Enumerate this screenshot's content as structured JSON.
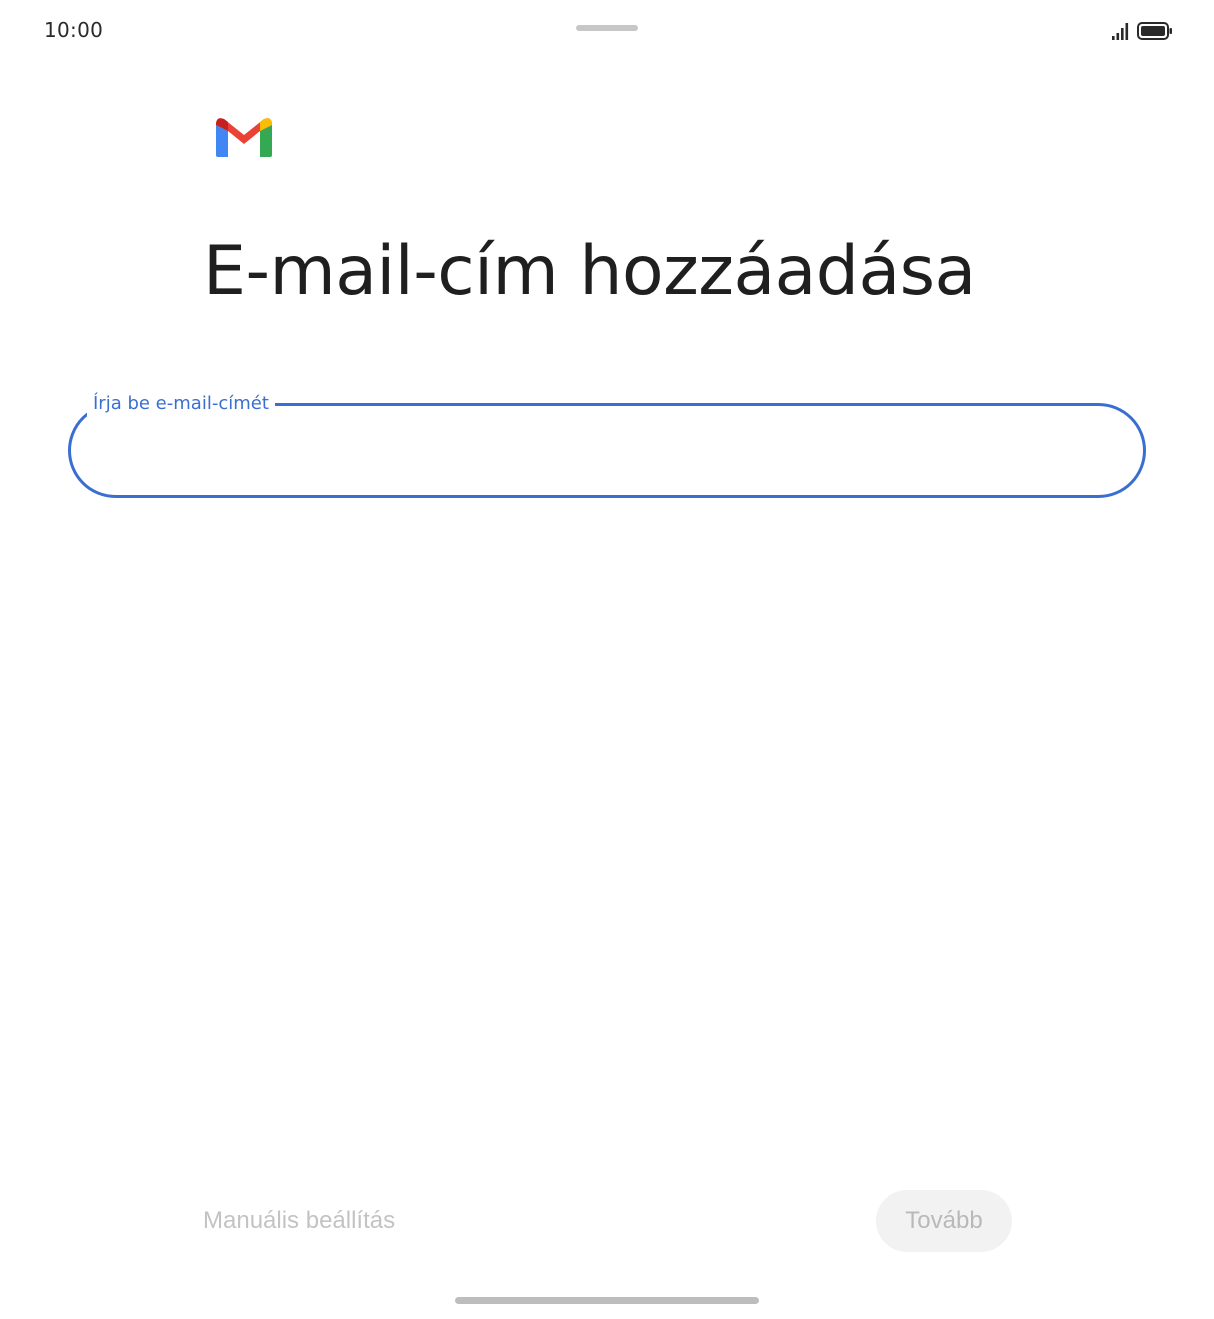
{
  "status_bar": {
    "time": "10:00",
    "icons": [
      "signal-icon",
      "battery-icon"
    ]
  },
  "header": {
    "logo": "gmail-logo",
    "title": "E-mail-cím hozzáadása"
  },
  "form": {
    "email_label": "Írja be e-mail-címét",
    "email_value": ""
  },
  "actions": {
    "manual_setup_label": "Manuális beállítás",
    "next_label": "Tovább"
  },
  "colors": {
    "accent": "#3a6fd1",
    "disabled_text": "#c3c3c3",
    "disabled_button_bg": "#f2f2f2",
    "gmail_red": "#ea4335",
    "gmail_blue": "#4285f4",
    "gmail_green": "#34a853",
    "gmail_yellow": "#fbbc04",
    "gmail_dark_red": "#c5221f"
  }
}
